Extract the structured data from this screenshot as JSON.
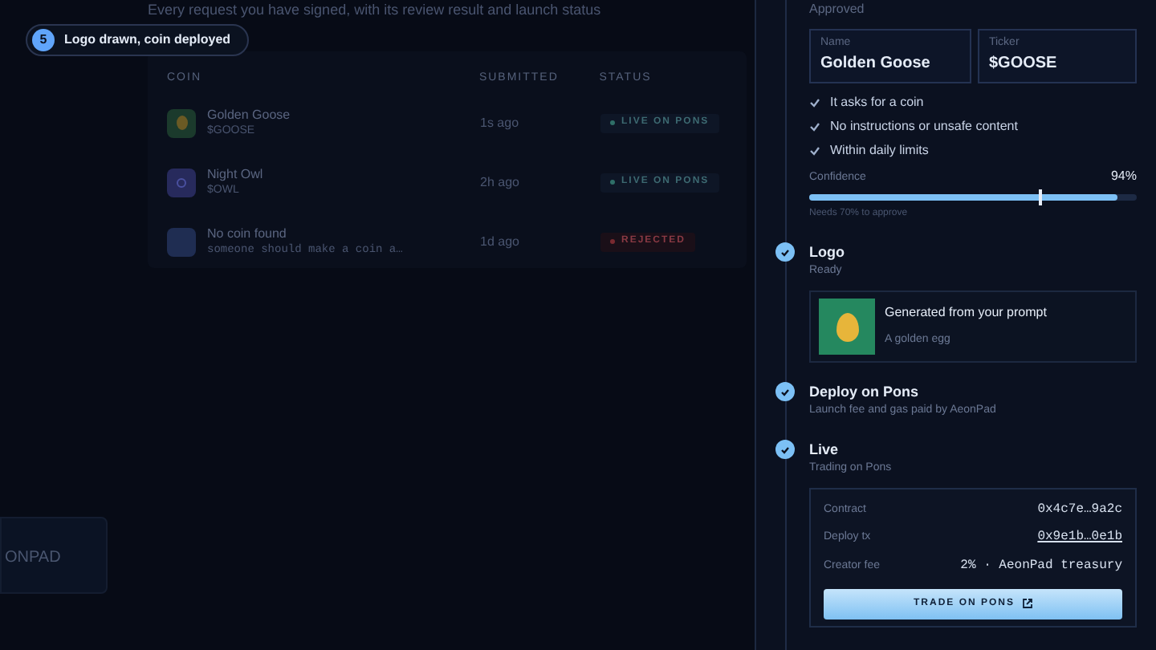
{
  "toast": {
    "count": "5",
    "text": "Logo drawn, coin deployed"
  },
  "history": {
    "subtitle": "Every request you have signed, with its review result and launch status",
    "columns": [
      "COIN",
      "SUBMITTED",
      "STATUS"
    ],
    "rows": [
      {
        "name": "Golden Goose",
        "sub": "$GOOSE",
        "mono": false,
        "submitted": "1s ago",
        "status": "LIVE ON PONS",
        "kind": "live"
      },
      {
        "name": "Night Owl",
        "sub": "$OWL",
        "mono": false,
        "submitted": "2h ago",
        "status": "LIVE ON PONS",
        "kind": "live"
      },
      {
        "name": "No coin found",
        "sub": "someone should make a coin a…",
        "mono": true,
        "submitted": "1d ago",
        "status": "REJECTED",
        "kind": "rejected"
      }
    ]
  },
  "side_card": {
    "title": "ONPAD"
  },
  "review": {
    "status": "Approved",
    "fields": [
      {
        "label": "Name",
        "value": "Golden Goose"
      },
      {
        "label": "Ticker",
        "value": "$GOOSE"
      }
    ],
    "checks": [
      "It asks for a coin",
      "No instructions or unsafe content",
      "Within daily limits"
    ],
    "confidence": {
      "label": "Confidence",
      "reading": "94%",
      "level": 0.94,
      "note": "Needs 70% to approve"
    }
  },
  "steps": [
    {
      "title": "Logo",
      "detail": "Ready",
      "done": true,
      "kind": "logo",
      "card": {
        "title": "Generated from your prompt",
        "caption": "A golden egg"
      }
    },
    {
      "title": "Deploy on Pons",
      "detail": "Launch fee and gas paid by AeonPad",
      "done": true,
      "kind": "plain"
    },
    {
      "title": "Live",
      "detail": "Trading on Pons",
      "done": true,
      "kind": "live",
      "info": [
        {
          "label": "Contract",
          "value": "0x4c7e…9a2c",
          "link": false
        },
        {
          "label": "Deploy tx",
          "value": "0x9e1b…0e1b",
          "link": true
        },
        {
          "label": "Creator fee",
          "value": "2% · AeonPad treasury",
          "link": false
        }
      ],
      "button": "TRADE ON PONS"
    }
  ]
}
